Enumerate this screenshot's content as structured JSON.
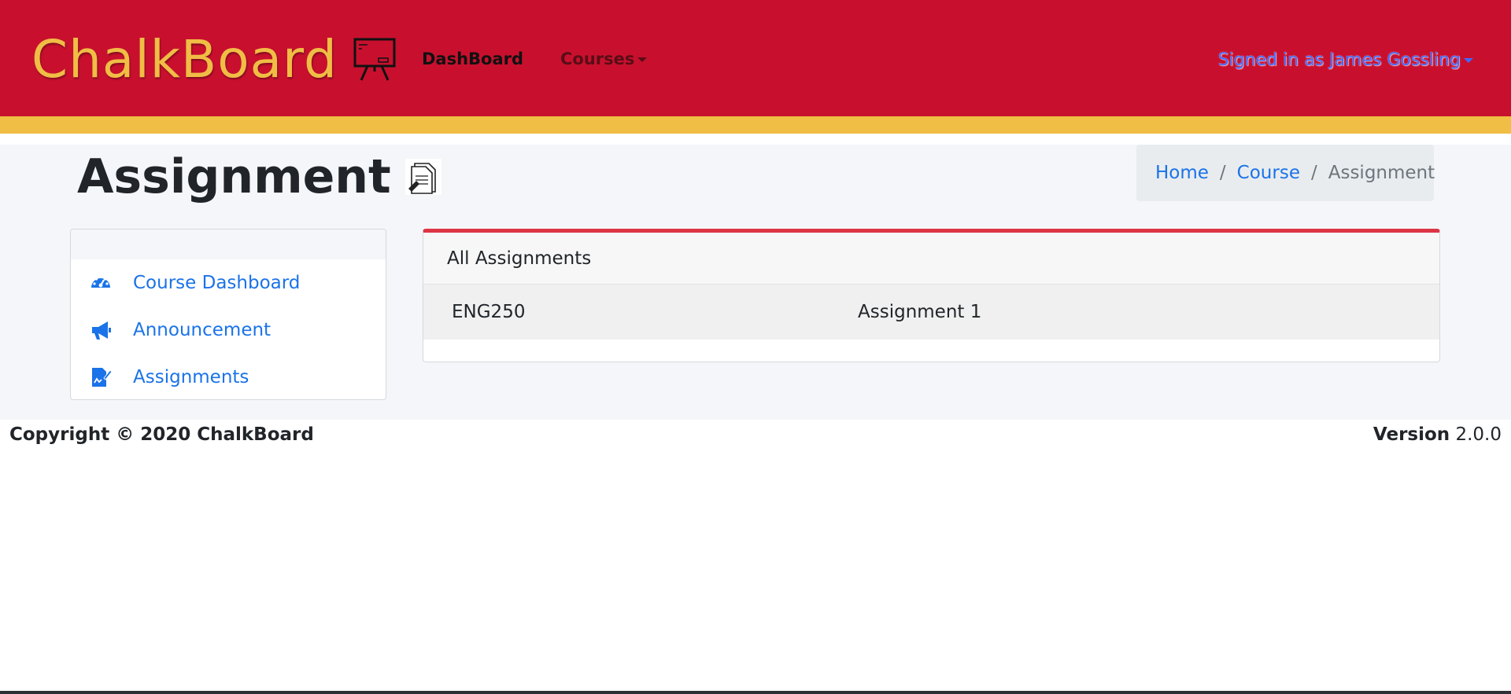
{
  "brand": {
    "name": "ChalkBoard",
    "logo_icon": "chalkboard-easel-icon"
  },
  "nav": {
    "dashboard_label": "DashBoard",
    "courses_label": "Courses",
    "user_label": "Signed in as James Gossling"
  },
  "page": {
    "title": "Assignment",
    "title_icon": "document-edit-icon"
  },
  "breadcrumb": {
    "home": "Home",
    "course": "Course",
    "current": "Assignment"
  },
  "sidebar": {
    "items": [
      {
        "label": "Course Dashboard",
        "icon": "speedometer-icon"
      },
      {
        "label": "Announcement",
        "icon": "megaphone-icon"
      },
      {
        "label": "Assignments",
        "icon": "file-signature-icon"
      }
    ]
  },
  "assignments": {
    "header": "All Assignments",
    "rows": [
      {
        "course": "ENG250",
        "name": "Assignment 1"
      }
    ]
  },
  "footer": {
    "copyright": "Copyright © 2020 ChalkBoard",
    "version_label": "Version",
    "version_value": "2.0.0"
  },
  "colors": {
    "navbar": "#c8102e",
    "gold": "#f0bd45",
    "link": "#1a73e8",
    "card_accent": "#dc3545"
  }
}
